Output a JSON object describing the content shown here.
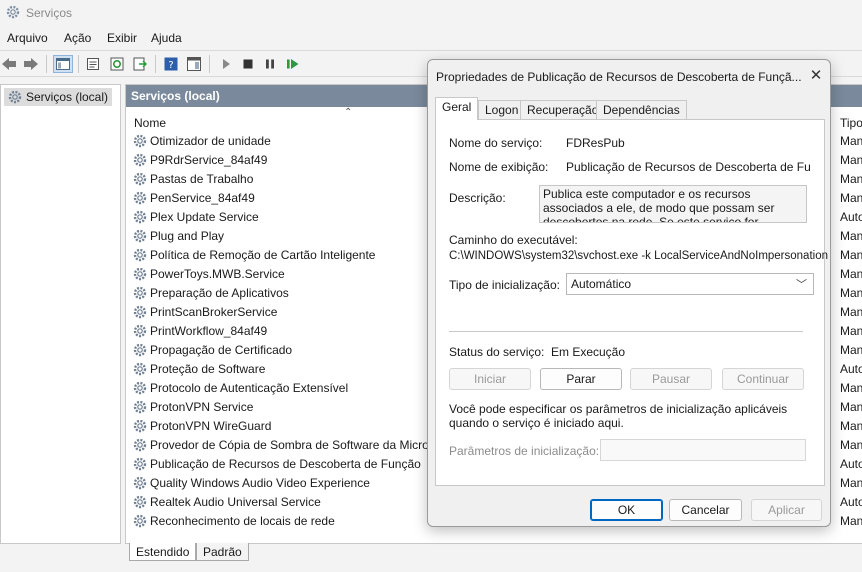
{
  "app": {
    "title": "Serviços"
  },
  "menu": [
    "Arquivo",
    "Ação",
    "Exibir",
    "Ajuda"
  ],
  "tree": {
    "root_label": "Serviços (local)"
  },
  "pane": {
    "header": "Serviços (local)",
    "columns": {
      "name": "Nome",
      "startup": "Tipo"
    }
  },
  "services": [
    {
      "name": "Otimizador de unidade",
      "startup": "Man"
    },
    {
      "name": "P9RdrService_84af49",
      "startup": "Man"
    },
    {
      "name": "Pastas de Trabalho",
      "startup": "Man"
    },
    {
      "name": "PenService_84af49",
      "startup": "Man"
    },
    {
      "name": "Plex Update Service",
      "startup": "Auto"
    },
    {
      "name": "Plug and Play",
      "startup": "Man"
    },
    {
      "name": "Política de Remoção de Cartão Inteligente",
      "startup": "Man"
    },
    {
      "name": "PowerToys.MWB.Service",
      "startup": "Man"
    },
    {
      "name": "Preparação de Aplicativos",
      "startup": "Man"
    },
    {
      "name": "PrintScanBrokerService",
      "startup": "Man"
    },
    {
      "name": "PrintWorkflow_84af49",
      "startup": "Man"
    },
    {
      "name": "Propagação de Certificado",
      "startup": "Man"
    },
    {
      "name": "Proteção de Software",
      "startup": "Auto"
    },
    {
      "name": "Protocolo de Autenticação Extensível",
      "startup": "Man"
    },
    {
      "name": "ProtonVPN Service",
      "startup": "Man"
    },
    {
      "name": "ProtonVPN WireGuard",
      "startup": "Man"
    },
    {
      "name": "Provedor de Cópia de Sombra de Software da Micros",
      "startup": "Man"
    },
    {
      "name": "Publicação de Recursos de Descoberta de Função",
      "startup": "Auto"
    },
    {
      "name": "Quality Windows Audio Video Experience",
      "startup": "Man"
    },
    {
      "name": "Realtek Audio Universal Service",
      "startup": "Auto"
    },
    {
      "name": "Reconhecimento de locais de rede",
      "startup": "Man"
    }
  ],
  "bottom_tabs": [
    "Estendido",
    "Padrão"
  ],
  "dialog": {
    "title": "Propriedades de Publicação de Recursos de Descoberta de Funçã...",
    "tabs": [
      "Geral",
      "Logon",
      "Recuperação",
      "Dependências"
    ],
    "service_name_label": "Nome do serviço:",
    "service_name": "FDResPub",
    "display_name_label": "Nome de exibição:",
    "display_name": "Publicação de Recursos de Descoberta de Funçã",
    "description_label": "Descrição:",
    "description": "Publica este computador e os recursos associados a ele, de modo que possam ser descobertos na rede. Se este serviço for interrompido, os recursos de rede",
    "path_label": "Caminho do executável:",
    "path": "C:\\WINDOWS\\system32\\svchost.exe -k LocalServiceAndNoImpersonation",
    "startup_type_label": "Tipo de inicialização:",
    "startup_type": "Automático",
    "status_label": "Status do serviço:",
    "status": "Em Execução",
    "buttons": {
      "start": "Iniciar",
      "stop": "Parar",
      "pause": "Pausar",
      "resume": "Continuar"
    },
    "hint": "Você pode especificar os parâmetros de inicialização aplicáveis quando o serviço é iniciado aqui.",
    "params_label": "Parâmetros de inicialização:",
    "ok": "OK",
    "cancel": "Cancelar",
    "apply": "Aplicar"
  }
}
